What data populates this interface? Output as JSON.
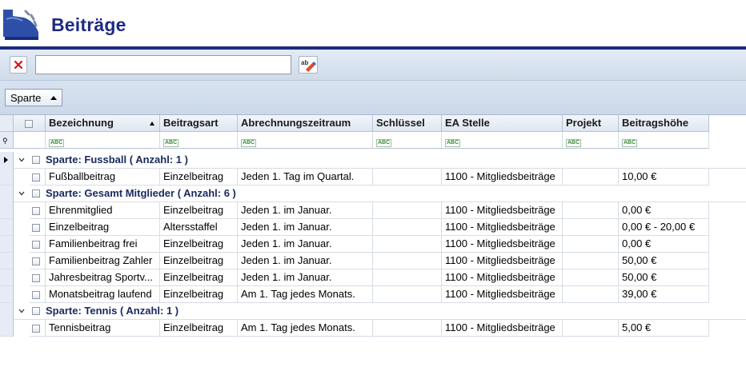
{
  "header": {
    "title": "Beiträge"
  },
  "toolbar": {
    "search_value": "",
    "clear_icon": "close-icon",
    "spell_icon": "spellcheck-icon"
  },
  "groupbar": {
    "group_field": "Sparte"
  },
  "columns": [
    "Bezeichnung",
    "Beitragsart",
    "Abrechnungszeitraum",
    "Schlüssel",
    "EA Stelle",
    "Projekt",
    "Beitragshöhe"
  ],
  "groups": [
    {
      "label": "Sparte: Fussball  ( Anzahl: 1 )",
      "rows": [
        [
          "Fußballbeitrag",
          "Einzelbeitrag",
          "Jeden 1. Tag im Quartal.",
          "",
          "1100 - Mitgliedsbeiträge",
          "",
          "10,00 €"
        ]
      ]
    },
    {
      "label": "Sparte: Gesamt Mitglieder  ( Anzahl: 6 )",
      "rows": [
        [
          "Ehrenmitglied",
          "Einzelbeitrag",
          "Jeden 1. im Januar.",
          "",
          "1100 - Mitgliedsbeiträge",
          "",
          "0,00 €"
        ],
        [
          "Einzelbeitrag",
          "Altersstaffel",
          "Jeden 1. im Januar.",
          "",
          "1100 - Mitgliedsbeiträge",
          "",
          "0,00 € - 20,00 €"
        ],
        [
          "Familienbeitrag frei",
          "Einzelbeitrag",
          "Jeden 1. im Januar.",
          "",
          "1100 - Mitgliedsbeiträge",
          "",
          "0,00 €"
        ],
        [
          "Familienbeitrag Zahler",
          "Einzelbeitrag",
          "Jeden 1. im Januar.",
          "",
          "1100 - Mitgliedsbeiträge",
          "",
          "50,00 €"
        ],
        [
          "Jahresbeitrag Sportv...",
          "Einzelbeitrag",
          "Jeden 1. im Januar.",
          "",
          "1100 - Mitgliedsbeiträge",
          "",
          "50,00 €"
        ],
        [
          "Monatsbeitrag laufend",
          "Einzelbeitrag",
          "Am 1. Tag jedes Monats.",
          "",
          "1100 - Mitgliedsbeiträge",
          "",
          "39,00 €"
        ]
      ]
    },
    {
      "label": "Sparte: Tennis  ( Anzahl: 1 )",
      "rows": [
        [
          "Tennisbeitrag",
          "Einzelbeitrag",
          "Am 1. Tag jedes Monats.",
          "",
          "1100 - Mitgliedsbeiträge",
          "",
          "5,00 €"
        ]
      ]
    }
  ]
}
